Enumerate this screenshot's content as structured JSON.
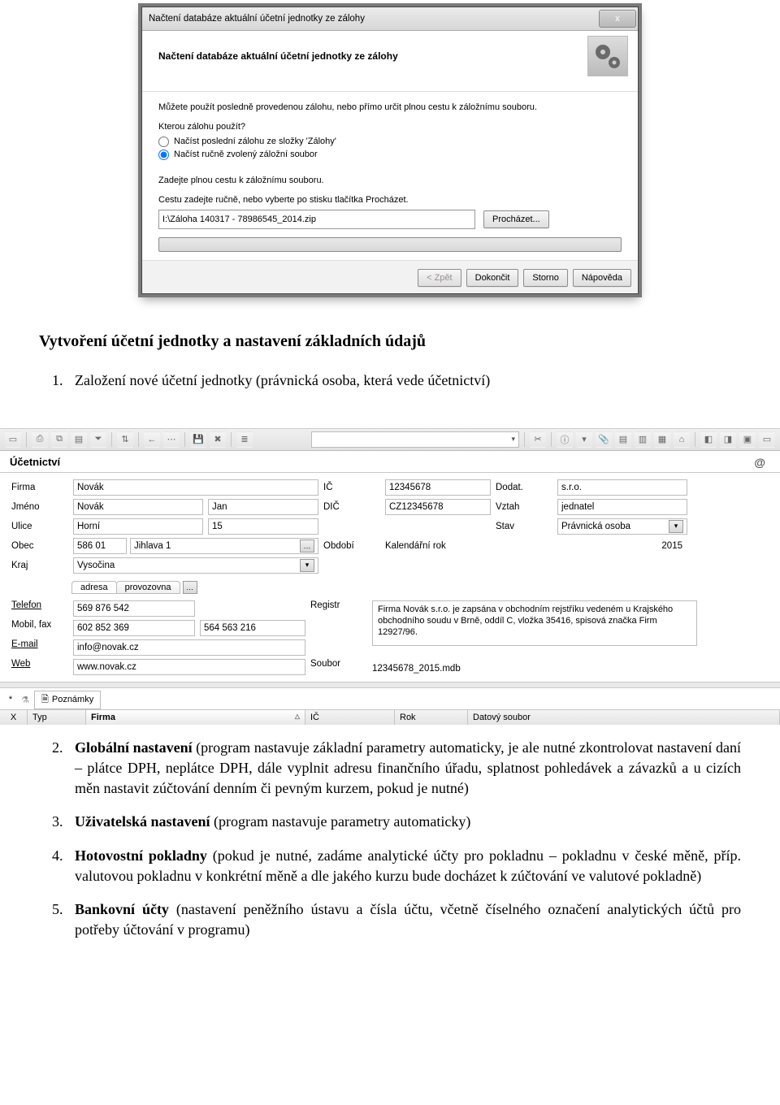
{
  "dialog": {
    "title": "Načtení databáze aktuální účetní jednotky ze zálohy",
    "heading": "Načtení databáze aktuální účetní jednotky ze zálohy",
    "intro": "Můžete použít posledně provedenou zálohu, nebo přímo určit plnou cestu k záložnímu souboru.",
    "question": "Kterou zálohu použít?",
    "radio1": "Načíst poslední zálohu ze složky 'Zálohy'",
    "radio2": "Načíst ručně zvolený záložní soubor",
    "path_label": "Zadejte plnou cestu k záložnímu souboru.",
    "path_hint": "Cestu zadejte ručně, nebo vyberte po stisku tlačítka Procházet.",
    "path_value": "I:\\Záloha 140317 - 78986545_2014.zip",
    "browse": "Procházet...",
    "back": "< Zpět",
    "finish": "Dokončit",
    "cancel": "Storno",
    "help": "Nápověda",
    "close_x": "x"
  },
  "text": {
    "heading": "Vytvoření účetní jednotky a nastavení základních údajů",
    "item1": "Založení nové účetní jednotky (právnická osoba, která vede účetnictví)",
    "item2a": "Globální nastavení",
    "item2b": " (program nastavuje základní parametry automaticky, je ale nutné zkontrolovat nastavení daní – plátce DPH, neplátce DPH, dále vyplnit adresu finančního úřadu, splatnost pohledávek a závazků a u cizích měn nastavit zúčtování denním či pevným kurzem, pokud je nutné)",
    "item3a": "Uživatelská nastavení",
    "item3b": " (program nastavuje parametry automaticky)",
    "item4a": "Hotovostní pokladny",
    "item4b": " (pokud je nutné, zadáme analytické účty pro pokladnu – pokladnu v české měně, příp. valutovou pokladnu v konkrétní měně a dle jakého kurzu bude docházet k zúčtování ve valutové pokladně)",
    "item5a": "Bankovní účty",
    "item5b": " (nastavení peněžního ústavu a čísla účtu, včetně číselného označení analytických účtů pro potřeby účtování v programu)"
  },
  "app": {
    "section": "Účetnictví",
    "labels": {
      "firma": "Firma",
      "jmeno": "Jméno",
      "ulice": "Ulice",
      "obec": "Obec",
      "kraj": "Kraj",
      "ic": "IČ",
      "dic": "DIČ",
      "obdobi": "Období",
      "dodat": "Dodat.",
      "vztah": "Vztah",
      "stav": "Stav",
      "telefon": "Telefon",
      "mobilfax": "Mobil, fax",
      "email": "E-mail",
      "web": "Web",
      "registr": "Registr",
      "soubor": "Soubor"
    },
    "values": {
      "firma": "Novák",
      "jmeno_last": "Novák",
      "jmeno_first": "Jan",
      "ulice": "Horní",
      "ulice_no": "15",
      "psc": "586 01",
      "mesto": "Jihlava 1",
      "kraj": "Vysočina",
      "ic": "12345678",
      "dic": "CZ12345678",
      "obdobi": "Kalendářní rok",
      "rok": "2015",
      "dodat": "s.r.o.",
      "vztah": "jednatel",
      "stav": "Právnická osoba",
      "telefon": "569 876 542",
      "mobil": "602 852 369",
      "fax": "564 563 216",
      "email": "info@novak.cz",
      "web": "www.novak.cz",
      "registr": "Firma Novák s.r.o. je zapsána v obchodním rejstříku vedeném u Krajského obchodního soudu v Brně, oddíl C, vložka 35416, spisová značka Firm 12927/96.",
      "soubor": "12345678_2015.mdb"
    },
    "tabs_mini": {
      "adresa": "adresa",
      "provozovna": "provozovna"
    },
    "bottom": {
      "star": "*",
      "poznamky": "Poznámky",
      "xcol": "X",
      "typ": "Typ",
      "firma": "Firma",
      "ic": "IČ",
      "rok": "Rok",
      "datsoubor": "Datový soubor"
    }
  }
}
